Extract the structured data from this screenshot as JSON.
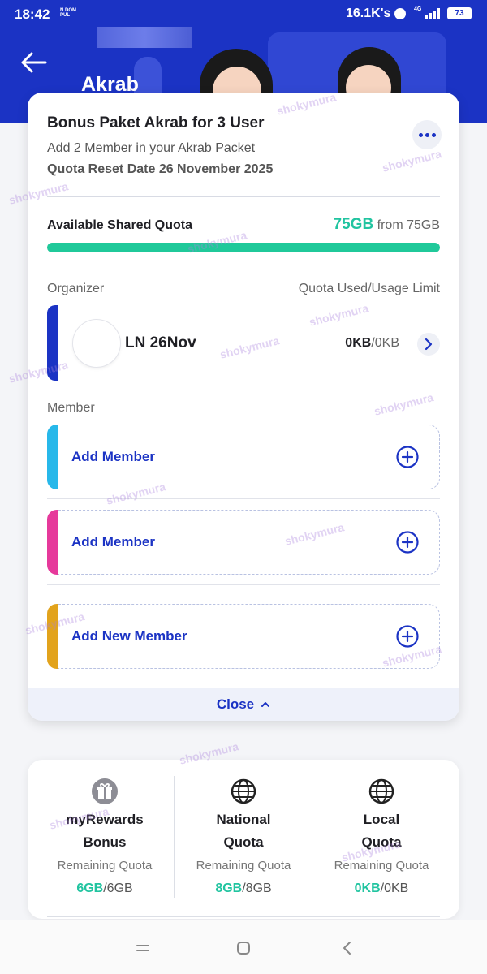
{
  "status": {
    "time": "18:42",
    "carrier": "N DOM PUL",
    "speed": "16.1K's",
    "network": "4G",
    "battery": "73"
  },
  "header": {
    "title": "Akrab"
  },
  "package": {
    "title": "Bonus Paket Akrab for 3 User",
    "subtitle": "Add 2 Member in your Akrab Packet",
    "reset": "Quota Reset Date 26 November 2025"
  },
  "shared_quota": {
    "label": "Available Shared Quota",
    "value": "75GB",
    "from": "from 75GB",
    "fill_fraction": 1.0
  },
  "organizer": {
    "section_label": "Organizer",
    "usage_header": "Quota Used/Usage Limit",
    "name": "LN 26Nov",
    "used": "0KB",
    "limit": "/0KB"
  },
  "members": {
    "section_label": "Member",
    "slots": [
      {
        "label": "Add Member",
        "color": "#27b8ea"
      },
      {
        "label": "Add Member",
        "color": "#e6399b"
      },
      {
        "label": "Add New Member",
        "color": "#e2a31c"
      }
    ]
  },
  "close": {
    "label": "Close"
  },
  "quotas": [
    {
      "name_line1": "myRewards",
      "name_line2": "Bonus",
      "remaining_label": "Remaining Quota",
      "value": "6GB",
      "limit": "/6GB",
      "icon": "gift-icon"
    },
    {
      "name_line1": "National",
      "name_line2": "Quota",
      "remaining_label": "Remaining Quota",
      "value": "8GB",
      "limit": "/8GB",
      "icon": "globe-icon"
    },
    {
      "name_line1": "Local",
      "name_line2": "Quota",
      "remaining_label": "Remaining Quota",
      "value": "0KB",
      "limit": "/0KB",
      "icon": "globe-icon"
    }
  ],
  "watermark": "shokymura",
  "colors": {
    "brand_blue": "#1b33c4",
    "accent_green": "#21c4a0"
  }
}
